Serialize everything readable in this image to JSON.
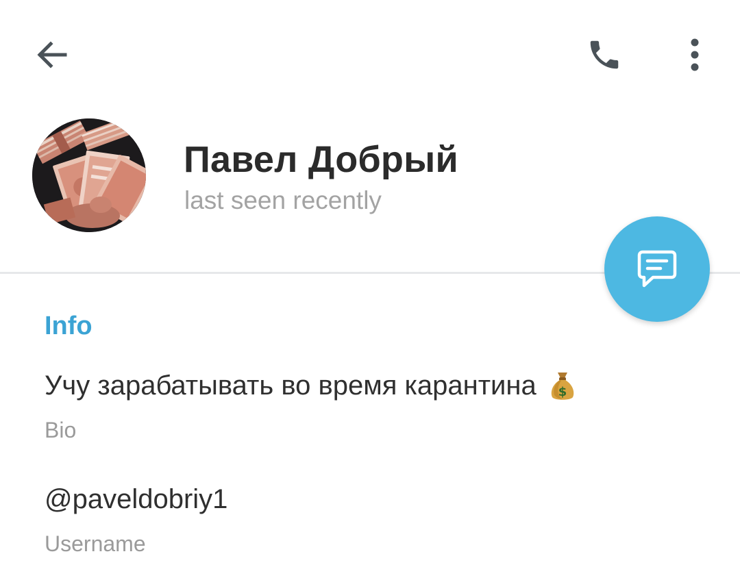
{
  "toolbar": {
    "back_icon": "arrow-left-icon",
    "call_icon": "phone-icon",
    "more_icon": "more-vertical-icon"
  },
  "profile": {
    "name": "Павел Добрый",
    "status": "last seen recently",
    "avatar": "stack-of-banknotes-photo"
  },
  "fab": {
    "icon": "message-icon",
    "color": "#4db8e2"
  },
  "info": {
    "title": "Info",
    "bio": {
      "value": "Учу зарабатывать во время карантина",
      "emoji": "money-bag-icon",
      "label": "Bio"
    },
    "username": {
      "value": "@paveldobriy1",
      "label": "Username"
    }
  },
  "colors": {
    "accent": "#3ba3d4",
    "fab": "#4db8e2",
    "icon": "#4a5258",
    "name_text": "#2b2b2b",
    "secondary_text": "#a3a3a3"
  }
}
